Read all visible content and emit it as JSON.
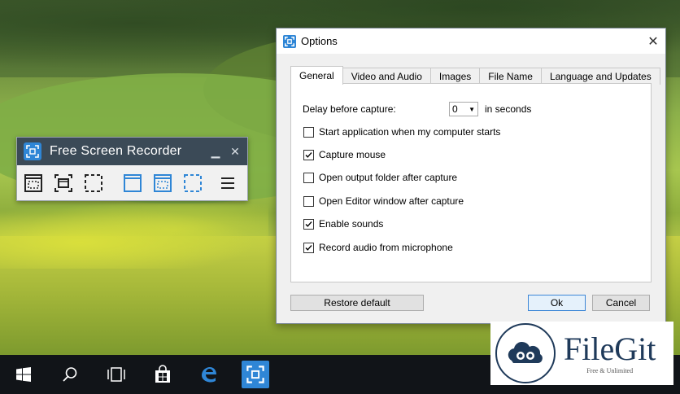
{
  "recorder": {
    "title": "Free Screen Recorder",
    "minimize": "▁",
    "close": "✕",
    "tools": [
      "capture-region-icon",
      "capture-window-icon",
      "capture-fullscreen-icon",
      "record-region-icon",
      "record-window-icon",
      "record-fullscreen-icon",
      "menu-icon"
    ]
  },
  "options": {
    "title": "Options",
    "close": "✕",
    "tabs": [
      "General",
      "Video and Audio",
      "Images",
      "File Name",
      "Language and Updates"
    ],
    "active_tab": "General",
    "delay_label": "Delay before capture:",
    "delay_value": "0",
    "delay_unit": "in seconds",
    "checkboxes": [
      {
        "label": "Start application when my computer starts",
        "checked": false
      },
      {
        "label": "Capture mouse",
        "checked": true
      },
      {
        "label": "Open output folder after capture",
        "checked": false
      },
      {
        "label": "Open Editor window after capture",
        "checked": false
      },
      {
        "label": "Enable sounds",
        "checked": true
      },
      {
        "label": "Record audio from microphone",
        "checked": true
      }
    ],
    "restore_label": "Restore default",
    "ok_label": "Ok",
    "cancel_label": "Cancel"
  },
  "taskbar": {
    "items": [
      "windows-start-icon",
      "search-icon",
      "task-view-icon",
      "store-icon",
      "edge-icon",
      "screen-recorder-icon"
    ]
  },
  "watermark": {
    "name": "FileGit",
    "tagline": "Free & Unlimited"
  },
  "colors": {
    "accent": "#2f86d6",
    "recorder_title_bg": "#3b4a57",
    "taskbar_bg": "#111418"
  }
}
